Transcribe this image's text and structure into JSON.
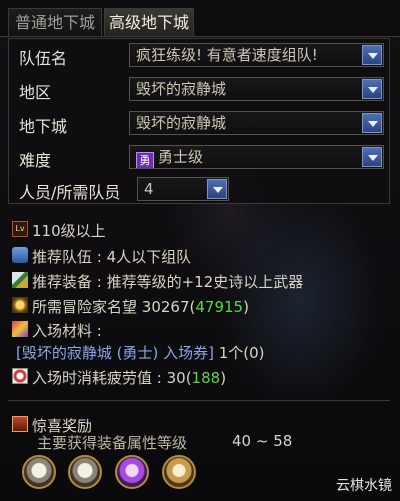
{
  "tabs": [
    "普通地下城",
    "高级地下城"
  ],
  "form": {
    "party_name": {
      "label": "队伍名",
      "value": "疯狂练级! 有意者速度组队!"
    },
    "region": {
      "label": "地区",
      "value": "毁坏的寂静城"
    },
    "dungeon": {
      "label": "地下城",
      "value": "毁坏的寂静城"
    },
    "difficulty": {
      "label": "难度",
      "badge": "勇",
      "value": "勇士级"
    },
    "members": {
      "label": "人员/所需队员",
      "value": "4"
    }
  },
  "info": {
    "level": "110级以上",
    "level_icon": "Lv",
    "recommended_party": "推荐队伍 : 4人以下组队",
    "recommended_gear": "推荐装备 : 推荐等级的+12史诗以上武器",
    "reputation_label": "所需冒险家名望",
    "reputation_value": "30267",
    "reputation_extra": "47915",
    "materials_label": "入场材料 :",
    "ticket_name": "[毁坏的寂静城 (勇士) 入场券]",
    "ticket_count": "1个(0)",
    "fatigue_label": "入场时消耗疲劳值 : 30",
    "fatigue_extra": "188"
  },
  "rewards": {
    "title": "惊喜奖励",
    "subtitle": "主要获得装备属性等级",
    "range": "40 ~ 58"
  },
  "watermark": "云棋水镜",
  "colors": {
    "accent_green": "#57d64a",
    "arrow_blue": "#3b5aa0",
    "badge_purple": "#6b2fb3"
  }
}
